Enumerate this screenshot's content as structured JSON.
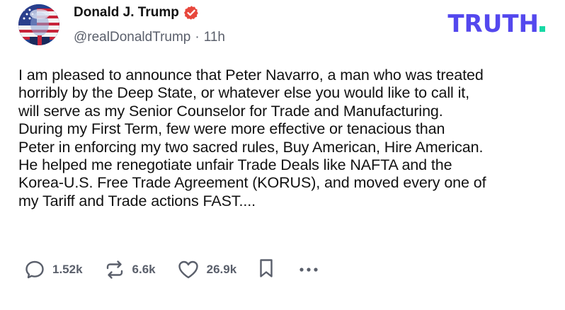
{
  "author": {
    "display_name": "Donald J. Trump",
    "handle": "@realDonaldTrump",
    "separator": "·",
    "time": "11h",
    "verified": true,
    "avatar": "profile-photo"
  },
  "brand": {
    "name": "TRUTH",
    "color": "#5448EE",
    "dot_color": "#17D9A5"
  },
  "post": {
    "text": "I am pleased to announce that Peter Navarro, a man who was treated\nhorribly by the Deep State, or whatever else you would like to call it,\nwill serve as my Senior Counselor for Trade and Manufacturing.\nDuring my First Term, few were more effective or tenacious than\nPeter in enforcing my two sacred rules, Buy American, Hire American.\nHe helped me renegotiate unfair Trade Deals like NAFTA and the\nKorea-U.S. Free Trade Agreement (KORUS), and moved every one of\nmy Tariff and Trade actions FAST...."
  },
  "actions": {
    "replies": {
      "icon": "reply-icon",
      "count": "1.52k"
    },
    "retruths": {
      "icon": "retruth-icon",
      "count": "6.6k"
    },
    "likes": {
      "icon": "heart-icon",
      "count": "26.9k"
    },
    "bookmark": {
      "icon": "bookmark-icon"
    },
    "more": {
      "icon": "more-icon"
    }
  },
  "colors": {
    "text": "#111111",
    "muted": "#5A5F6B",
    "verified": "#E8473C"
  }
}
